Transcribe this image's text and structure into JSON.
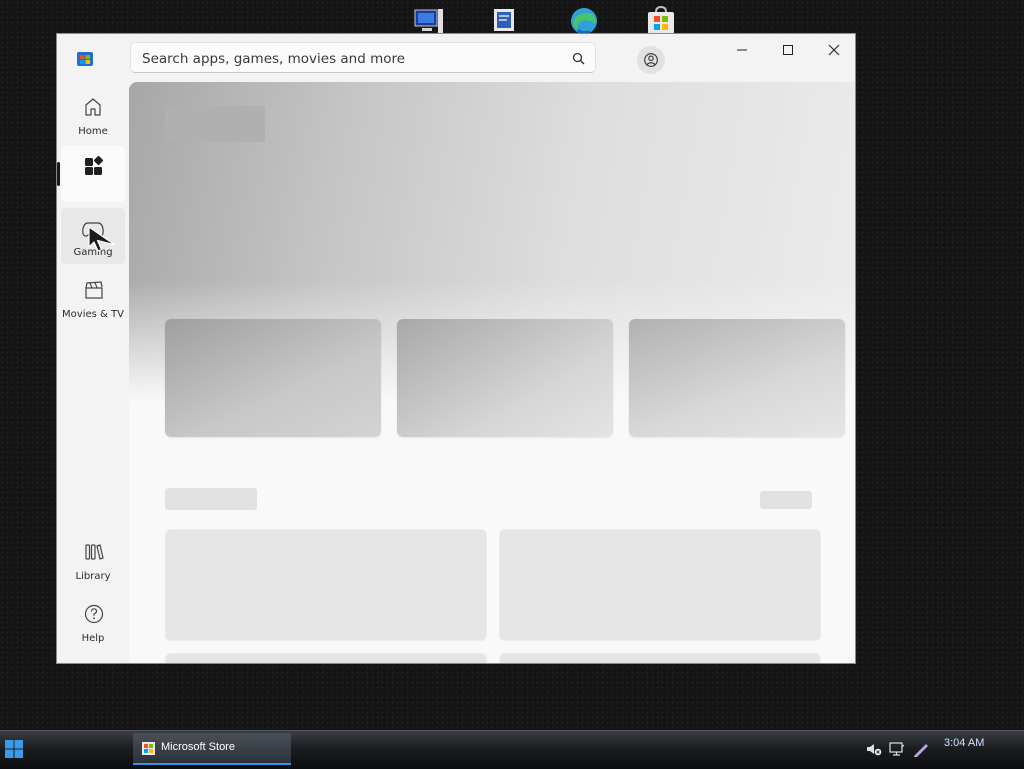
{
  "search": {
    "placeholder": "Search apps, games, movies and more"
  },
  "sidebar": {
    "items": [
      {
        "label": "Home",
        "icon": "home-icon"
      },
      {
        "label": "",
        "icon": "apps-icon",
        "selected": true
      },
      {
        "label": "Gaming",
        "icon": "gaming-controller-icon"
      },
      {
        "label": "Movies & TV",
        "icon": "movies-clapper-icon"
      }
    ],
    "bottom": [
      {
        "label": "Library",
        "icon": "library-icon"
      },
      {
        "label": "Help",
        "icon": "help-icon"
      }
    ]
  },
  "taskbar": {
    "active_app": "Microsoft Store",
    "clock": "3:04 AM"
  },
  "colors": {
    "accent": "#3a8ee6",
    "content_bg": "#f9f9f9",
    "placeholder_gray": "#e5e5e5"
  }
}
